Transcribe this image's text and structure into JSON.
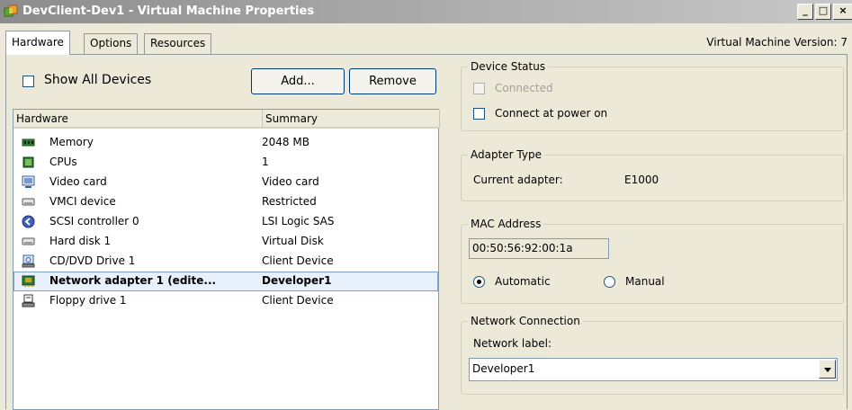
{
  "window": {
    "title": "DevClient-Dev1 - Virtual Machine Properties",
    "min_glyph": "_",
    "max_glyph": "□",
    "close_glyph": "×"
  },
  "tabs": [
    {
      "label": "Hardware",
      "active": true
    },
    {
      "label": "Options",
      "active": false
    },
    {
      "label": "Resources",
      "active": false
    }
  ],
  "vm_version": "Virtual Machine Version: 7",
  "toolbar": {
    "show_all_devices": "Show All Devices",
    "show_all_checked": false,
    "add_label": "Add...",
    "remove_label": "Remove"
  },
  "hardware_list": {
    "columns": [
      "Hardware",
      "Summary"
    ],
    "rows": [
      {
        "icon": "memory-icon",
        "name": "Memory",
        "summary": "2048 MB",
        "selected": false
      },
      {
        "icon": "cpu-icon",
        "name": "CPUs",
        "summary": "1",
        "selected": false
      },
      {
        "icon": "monitor-icon",
        "name": "Video card",
        "summary": "Video card",
        "selected": false
      },
      {
        "icon": "device-icon",
        "name": "VMCI device",
        "summary": "Restricted",
        "selected": false
      },
      {
        "icon": "scsi-controller-icon",
        "name": "SCSI controller 0",
        "summary": "LSI Logic SAS",
        "selected": false
      },
      {
        "icon": "hard-disk-icon",
        "name": "Hard disk 1",
        "summary": "Virtual Disk",
        "selected": false
      },
      {
        "icon": "cd-dvd-icon",
        "name": "CD/DVD Drive 1",
        "summary": "Client Device",
        "selected": false
      },
      {
        "icon": "network-adapter-icon",
        "name": "Network adapter 1 (edite...",
        "summary": "Developer1",
        "selected": true
      },
      {
        "icon": "floppy-drive-icon",
        "name": "Floppy drive 1",
        "summary": "Client Device",
        "selected": false
      }
    ]
  },
  "device_status": {
    "legend": "Device Status",
    "connected_label": "Connected",
    "connected_checked": false,
    "connected_enabled": false,
    "power_on_label": "Connect at power on",
    "power_on_checked": false
  },
  "adapter_type": {
    "legend": "Adapter Type",
    "current_label": "Current adapter:",
    "current_value": "E1000"
  },
  "mac_address": {
    "legend": "MAC Address",
    "value": "00:50:56:92:00:1a",
    "automatic_label": "Automatic",
    "manual_label": "Manual",
    "selected_mode": "Automatic"
  },
  "network_connection": {
    "legend": "Network Connection",
    "network_label": "Network label:",
    "selected": "Developer1"
  }
}
